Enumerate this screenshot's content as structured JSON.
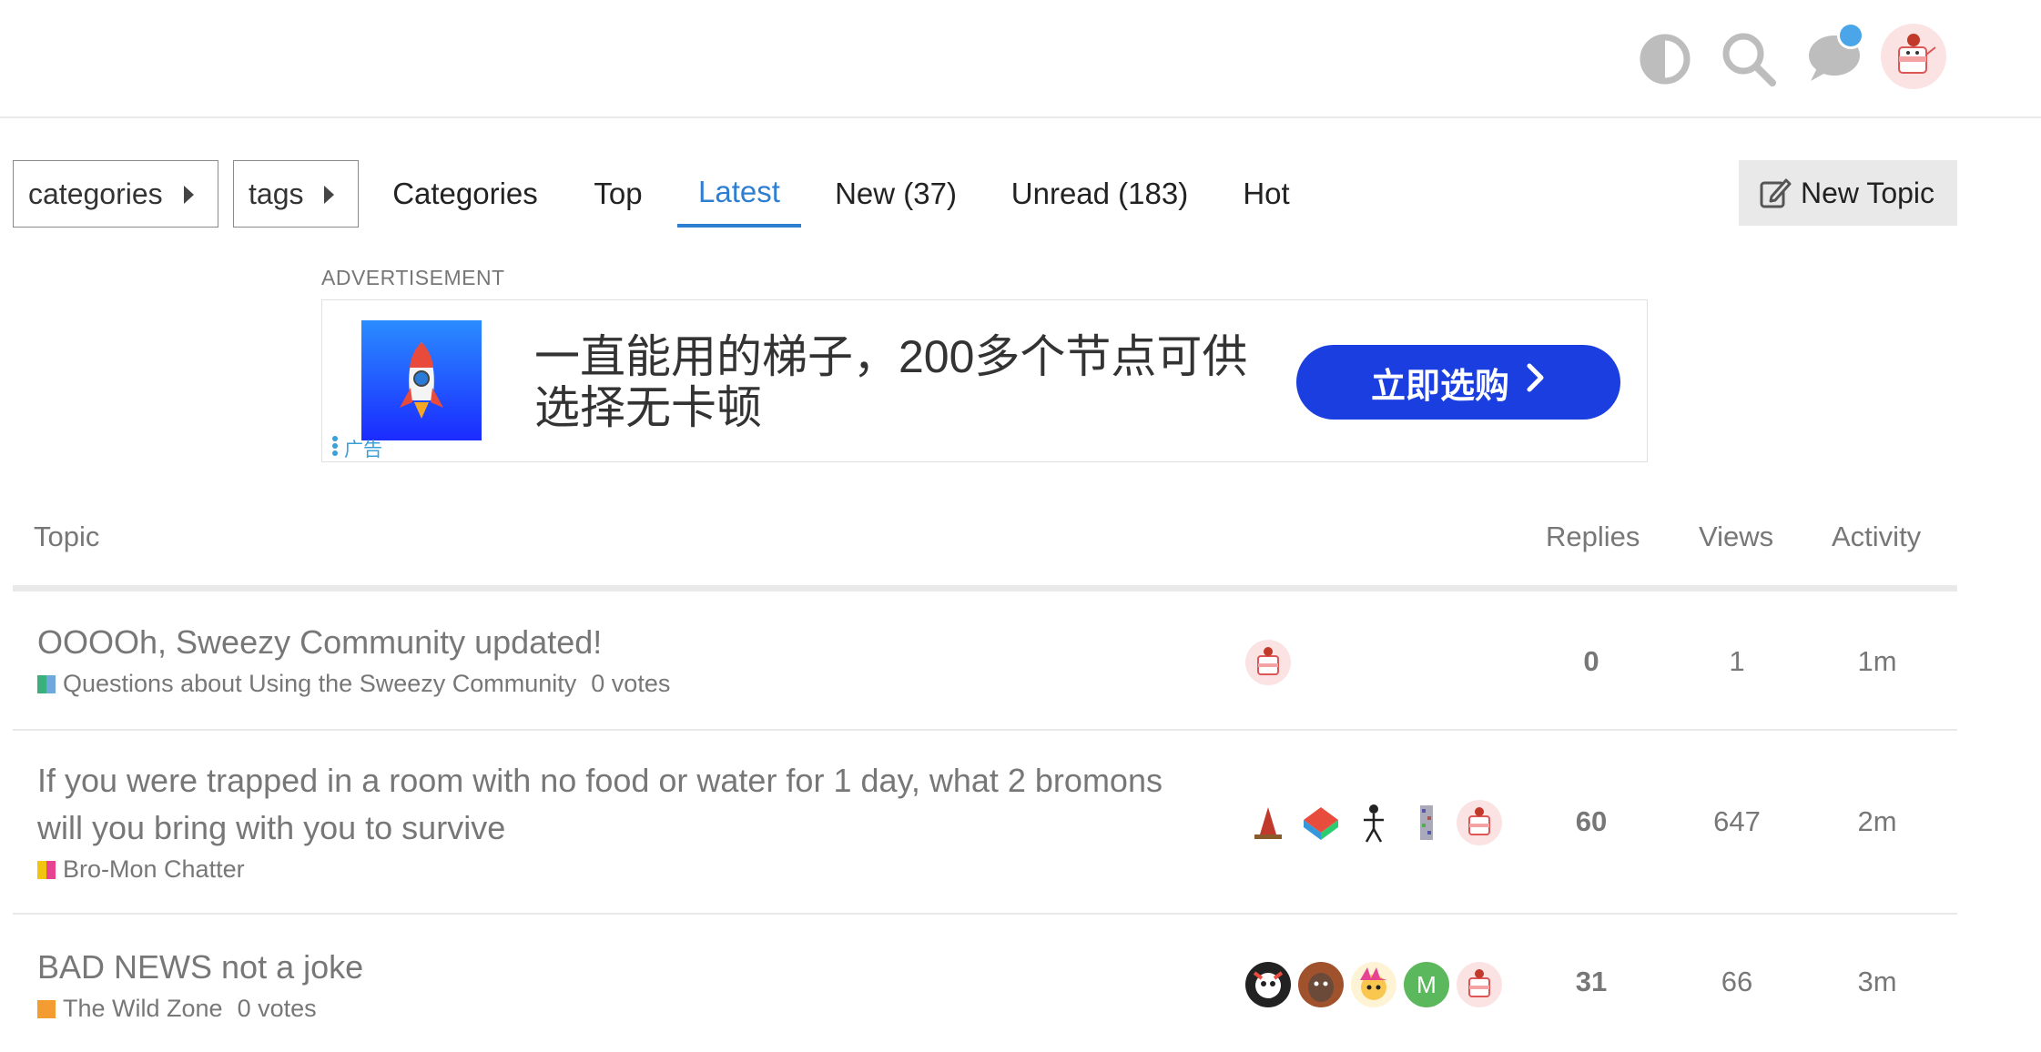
{
  "header": {
    "icons": [
      "contrast-icon",
      "search-icon",
      "chat-icon",
      "user-avatar"
    ],
    "accent": "#4aa6e8"
  },
  "nav": {
    "categories_dropdown": "categories",
    "tags_dropdown": "tags",
    "items": [
      {
        "label": "Categories"
      },
      {
        "label": "Top"
      },
      {
        "label": "Latest"
      },
      {
        "label": "New (37)"
      },
      {
        "label": "Unread (183)"
      },
      {
        "label": "Hot"
      }
    ],
    "active_color": "#2e7fd1",
    "new_topic": "New Topic"
  },
  "ad": {
    "label": "ADVERTISEMENT",
    "text": "一直能用的梯子，200多个节点可供选择无卡顿",
    "button": "立即选购",
    "mark": "广告",
    "button_color": "#1a3ee0"
  },
  "table": {
    "headers": {
      "topic": "Topic",
      "replies": "Replies",
      "views": "Views",
      "activity": "Activity"
    },
    "rows": [
      {
        "title": "OOOOh, Sweezy Community updated!",
        "category": "Questions about Using the Sweezy Community",
        "votes": "0 votes",
        "replies": "0",
        "views": "1",
        "activity": "1m"
      },
      {
        "title": "If you were trapped in a room with no food or water for 1 day, what 2 bromons will you bring with you to survive",
        "category": "Bro-Mon Chatter",
        "votes": "",
        "replies": "60",
        "views": "647",
        "activity": "2m"
      },
      {
        "title": "BAD NEWS not a joke",
        "category": "The Wild Zone",
        "votes": "0 votes",
        "replies": "31",
        "views": "66",
        "activity": "3m",
        "poster_letter": "M"
      }
    ]
  }
}
